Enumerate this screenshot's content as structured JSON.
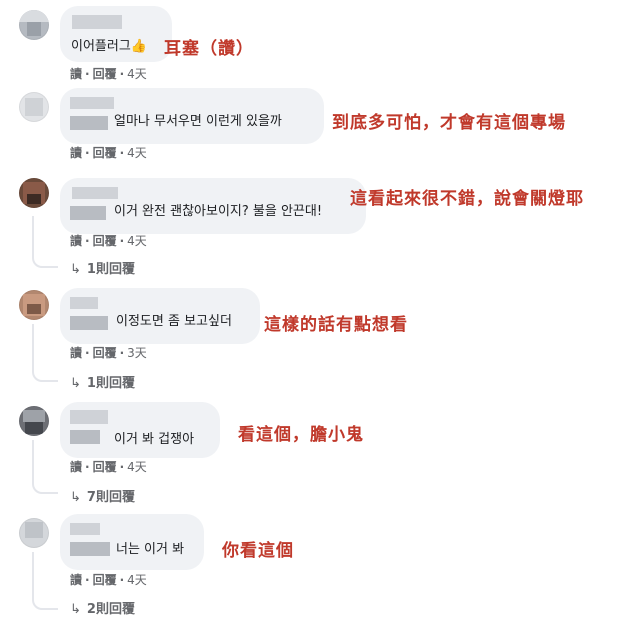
{
  "comments": [
    {
      "text": "이어플러그",
      "emoji": "👍",
      "actions": {
        "like": "讀",
        "reply": "回覆"
      },
      "time": "4天",
      "annotation": "耳塞（讚）"
    },
    {
      "text": "얼마나 무서우면 이런게 있을까",
      "actions": {
        "like": "讀",
        "reply": "回覆"
      },
      "time": "4天",
      "annotation": "到底多可怕，才會有這個專場"
    },
    {
      "text": "이거 완전 괜찮아보이지? 불을 안끈대!",
      "actions": {
        "like": "讀",
        "reply": "回覆"
      },
      "time": "4天",
      "replies": "1則回覆",
      "annotation": "這看起來很不錯，說會關燈耶"
    },
    {
      "text": "이정도면 좀 보고싶더",
      "actions": {
        "like": "讀",
        "reply": "回覆"
      },
      "time": "3天",
      "replies": "1則回覆",
      "annotation": "這樣的話有點想看"
    },
    {
      "text": "이거 봐 겁쟁아",
      "actions": {
        "like": "讀",
        "reply": "回覆"
      },
      "time": "4天",
      "replies": "7則回覆",
      "annotation": "看這個，膽小鬼"
    },
    {
      "text": "너는 이거 봐",
      "actions": {
        "like": "讀",
        "reply": "回覆"
      },
      "time": "4天",
      "replies": "2則回覆",
      "annotation": "你看這個"
    }
  ],
  "colors": {
    "bubble": "#f0f2f5",
    "meta": "#65676b",
    "annotation": "#c0392b"
  },
  "icons": {
    "reply_arrow": "reply-arrow-icon",
    "like_emoji": "thumbs-up-emoji"
  }
}
